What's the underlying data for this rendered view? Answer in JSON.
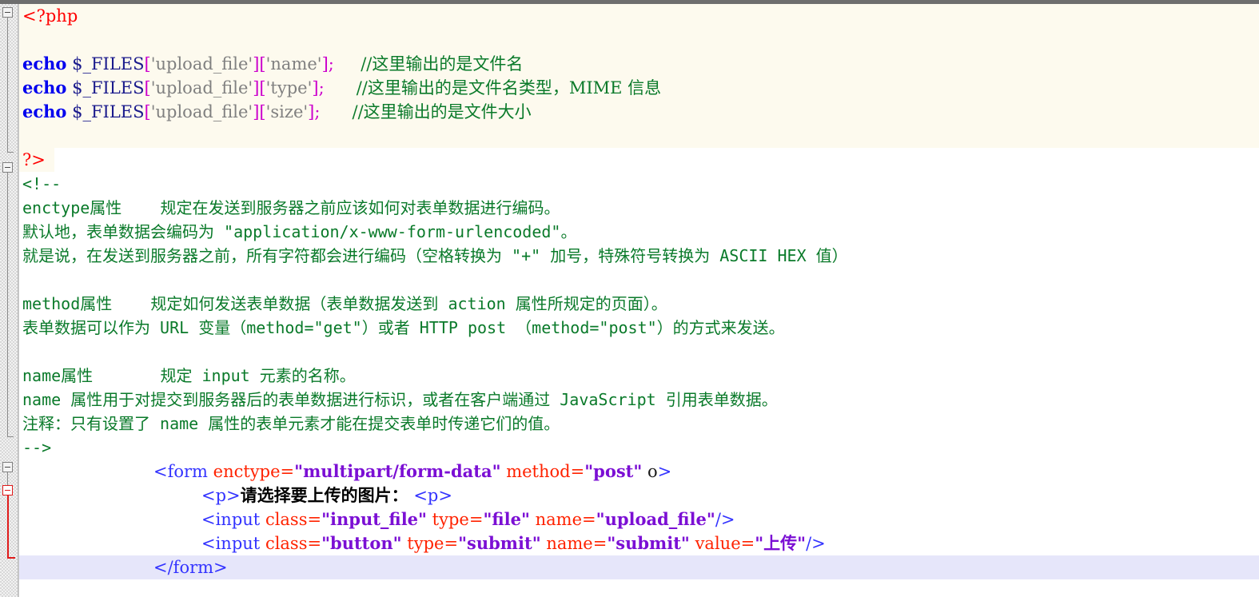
{
  "window": {
    "kind": "code-editor",
    "language": "PHP / HTML",
    "colors": {
      "php_block_background": "#fdfaee",
      "current_line_background": "#e6e6fa",
      "editor_background": "#ffffff",
      "gutter_background": "#f2f2f2",
      "fold_marker": "#808080",
      "fold_marker_active": "#e01b1b",
      "php_tag": "#ff0000",
      "keyword": "#0000ee",
      "variable": "#1a1a8c",
      "bracket": "#cc00cc",
      "string": "#808080",
      "comment": "#0a7a2a",
      "html_tag": "#3333ff",
      "attribute_name": "#ff2200",
      "attribute_value": "#7b0fd4"
    }
  },
  "gutter": {
    "markers": [
      {
        "name": "fold-marker-php-block",
        "state": "expanded",
        "color": "grey"
      },
      {
        "name": "fold-marker-html-comment",
        "state": "expanded",
        "color": "grey"
      },
      {
        "name": "fold-marker-form-element",
        "state": "expanded",
        "color": "grey"
      },
      {
        "name": "fold-marker-p-element",
        "state": "expanded",
        "color": "red"
      }
    ]
  },
  "code": {
    "lines": [
      {
        "id": 1,
        "region": "php",
        "tokens": [
          {
            "t": "<?php",
            "c": "t-php-tag"
          }
        ]
      },
      {
        "id": 2,
        "region": "php",
        "tokens": []
      },
      {
        "id": 3,
        "region": "php",
        "tokens": [
          {
            "t": "echo",
            "c": "t-keyword"
          },
          {
            "t": " ",
            "c": "t-plain"
          },
          {
            "t": "$_FILES",
            "c": "t-var"
          },
          {
            "t": "[",
            "c": "t-bracket"
          },
          {
            "t": "'upload_file'",
            "c": "t-string"
          },
          {
            "t": "]",
            "c": "t-bracket"
          },
          {
            "t": "[",
            "c": "t-bracket"
          },
          {
            "t": "'name'",
            "c": "t-string"
          },
          {
            "t": "]",
            "c": "t-bracket"
          },
          {
            "t": ";",
            "c": "t-semi"
          },
          {
            "t": "     ",
            "c": "t-plain"
          },
          {
            "t": "//这里输出的是文件名",
            "c": "t-comment"
          }
        ]
      },
      {
        "id": 4,
        "region": "php",
        "tokens": [
          {
            "t": "echo",
            "c": "t-keyword"
          },
          {
            "t": " ",
            "c": "t-plain"
          },
          {
            "t": "$_FILES",
            "c": "t-var"
          },
          {
            "t": "[",
            "c": "t-bracket"
          },
          {
            "t": "'upload_file'",
            "c": "t-string"
          },
          {
            "t": "]",
            "c": "t-bracket"
          },
          {
            "t": "[",
            "c": "t-bracket"
          },
          {
            "t": "'type'",
            "c": "t-string"
          },
          {
            "t": "]",
            "c": "t-bracket"
          },
          {
            "t": ";",
            "c": "t-semi"
          },
          {
            "t": "      ",
            "c": "t-plain"
          },
          {
            "t": "//这里输出的是文件名类型，MIME 信息",
            "c": "t-comment"
          }
        ]
      },
      {
        "id": 5,
        "region": "php",
        "tokens": [
          {
            "t": "echo",
            "c": "t-keyword"
          },
          {
            "t": " ",
            "c": "t-plain"
          },
          {
            "t": "$_FILES",
            "c": "t-var"
          },
          {
            "t": "[",
            "c": "t-bracket"
          },
          {
            "t": "'upload_file'",
            "c": "t-string"
          },
          {
            "t": "]",
            "c": "t-bracket"
          },
          {
            "t": "[",
            "c": "t-bracket"
          },
          {
            "t": "'size'",
            "c": "t-string"
          },
          {
            "t": "]",
            "c": "t-bracket"
          },
          {
            "t": ";",
            "c": "t-semi"
          },
          {
            "t": "      ",
            "c": "t-plain"
          },
          {
            "t": "//这里输出的是文件大小",
            "c": "t-comment"
          }
        ]
      },
      {
        "id": 6,
        "region": "php",
        "tokens": []
      },
      {
        "id": 7,
        "region": "php-tail",
        "tokens": [
          {
            "t": "?>",
            "c": "t-php-tag"
          }
        ]
      },
      {
        "id": 8,
        "region": "html",
        "tokens": [
          {
            "t": "<!--",
            "c": "t-comment"
          }
        ]
      },
      {
        "id": 9,
        "region": "html",
        "tokens": [
          {
            "t": "enctype属性    规定在发送到服务器之前应该如何对表单数据进行编码。",
            "c": "t-comment"
          }
        ]
      },
      {
        "id": 10,
        "region": "html",
        "tokens": [
          {
            "t": "默认地，表单数据会编码为 \"application/x-www-form-urlencoded\"。",
            "c": "t-comment"
          }
        ]
      },
      {
        "id": 11,
        "region": "html",
        "tokens": [
          {
            "t": "就是说，在发送到服务器之前，所有字符都会进行编码（空格转换为 \"+\" 加号，特殊符号转换为 ASCII HEX 值）",
            "c": "t-comment"
          }
        ]
      },
      {
        "id": 12,
        "region": "html",
        "tokens": []
      },
      {
        "id": 13,
        "region": "html",
        "tokens": [
          {
            "t": "method属性    规定如何发送表单数据（表单数据发送到 action 属性所规定的页面）。",
            "c": "t-comment"
          }
        ]
      },
      {
        "id": 14,
        "region": "html",
        "tokens": [
          {
            "t": "表单数据可以作为 URL 变量（method=\"get\"）或者 HTTP post （method=\"post\"）的方式来发送。",
            "c": "t-comment"
          }
        ]
      },
      {
        "id": 15,
        "region": "html",
        "tokens": []
      },
      {
        "id": 16,
        "region": "html",
        "tokens": [
          {
            "t": "name属性       规定 input 元素的名称。",
            "c": "t-comment"
          }
        ]
      },
      {
        "id": 17,
        "region": "html",
        "tokens": [
          {
            "t": "name 属性用于对提交到服务器后的表单数据进行标识，或者在客户端通过 JavaScript 引用表单数据。",
            "c": "t-comment"
          }
        ]
      },
      {
        "id": 18,
        "region": "html",
        "tokens": [
          {
            "t": "注释：只有设置了 name 属性的表单元素才能在提交表单时传递它们的值。",
            "c": "t-comment"
          }
        ]
      },
      {
        "id": 19,
        "region": "html",
        "tokens": [
          {
            "t": "-->",
            "c": "t-comment"
          }
        ]
      },
      {
        "id": 20,
        "region": "html",
        "indent": 168,
        "tokens": [
          {
            "t": "<form",
            "c": "t-htmltag"
          },
          {
            "t": " ",
            "c": "t-plain"
          },
          {
            "t": "enctype=",
            "c": "t-attr"
          },
          {
            "t": "\"multipart/form-data\"",
            "c": "t-attrval"
          },
          {
            "t": " ",
            "c": "t-plain"
          },
          {
            "t": "method=",
            "c": "t-attr"
          },
          {
            "t": "\"post\"",
            "c": "t-attrval"
          },
          {
            "t": " o",
            "c": "t-plain"
          },
          {
            "t": ">",
            "c": "t-htmltag"
          }
        ]
      },
      {
        "id": 21,
        "region": "html",
        "indent": 228,
        "tokens": [
          {
            "t": "<p>",
            "c": "t-htmltag"
          },
          {
            "t": "请选择要上传的图片：",
            "c": "t-cjk-bold"
          },
          {
            "t": " ",
            "c": "t-plain"
          },
          {
            "t": "<p>",
            "c": "t-htmltag"
          }
        ]
      },
      {
        "id": 22,
        "region": "html",
        "indent": 228,
        "tokens": [
          {
            "t": "<input",
            "c": "t-htmltag"
          },
          {
            "t": " ",
            "c": "t-plain"
          },
          {
            "t": "class=",
            "c": "t-attr"
          },
          {
            "t": "\"input_file\"",
            "c": "t-attrval"
          },
          {
            "t": " ",
            "c": "t-plain"
          },
          {
            "t": "type=",
            "c": "t-attr"
          },
          {
            "t": "\"file\"",
            "c": "t-attrval"
          },
          {
            "t": " ",
            "c": "t-plain"
          },
          {
            "t": "name=",
            "c": "t-attr"
          },
          {
            "t": "\"upload_file\"",
            "c": "t-attrval"
          },
          {
            "t": "/>",
            "c": "t-htmltag"
          }
        ]
      },
      {
        "id": 23,
        "region": "html",
        "indent": 228,
        "tokens": [
          {
            "t": "<input",
            "c": "t-htmltag"
          },
          {
            "t": " ",
            "c": "t-plain"
          },
          {
            "t": "class=",
            "c": "t-attr"
          },
          {
            "t": "\"button\"",
            "c": "t-attrval"
          },
          {
            "t": " ",
            "c": "t-plain"
          },
          {
            "t": "type=",
            "c": "t-attr"
          },
          {
            "t": "\"submit\"",
            "c": "t-attrval"
          },
          {
            "t": " ",
            "c": "t-plain"
          },
          {
            "t": "name=",
            "c": "t-attr"
          },
          {
            "t": "\"submit\"",
            "c": "t-attrval"
          },
          {
            "t": " ",
            "c": "t-plain"
          },
          {
            "t": "value=",
            "c": "t-attr"
          },
          {
            "t": "\"上传\"",
            "c": "t-attrval"
          },
          {
            "t": "/>",
            "c": "t-htmltag"
          }
        ]
      },
      {
        "id": 24,
        "region": "html",
        "indent": 168,
        "current": true,
        "tokens": [
          {
            "t": "</form>",
            "c": "t-htmltag"
          }
        ]
      }
    ]
  }
}
